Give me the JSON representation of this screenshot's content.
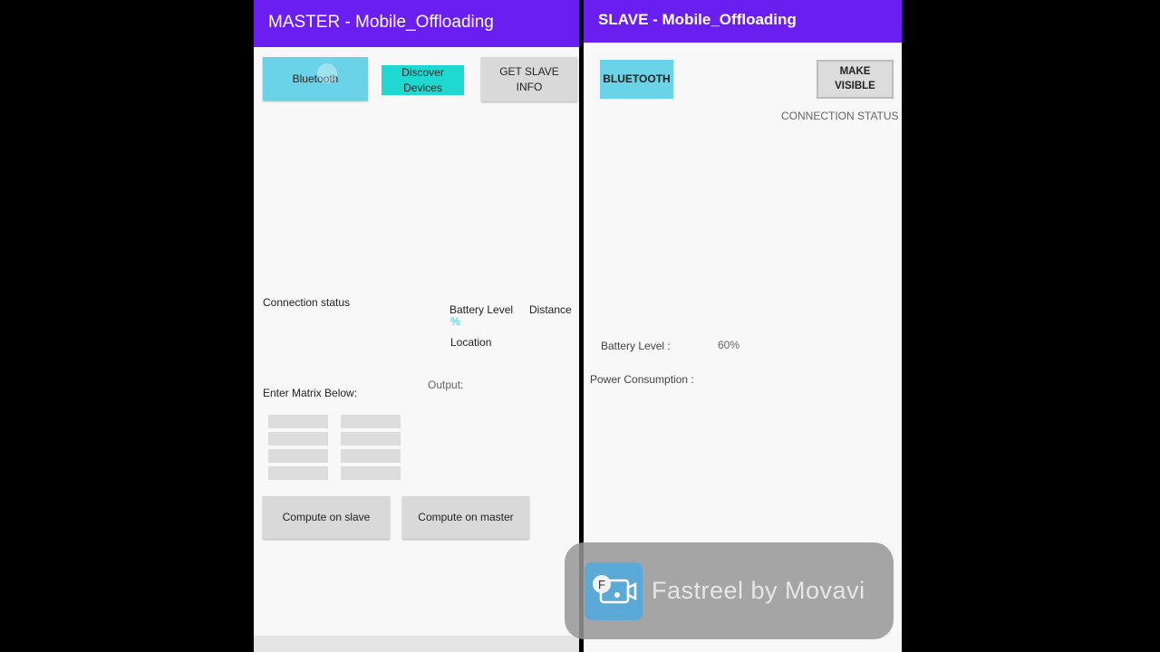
{
  "master": {
    "title": "MASTER - Mobile_Offloading",
    "bluetooth_button": "Bluetooth",
    "discover_button": "Discover Devices",
    "get_slave_info_button": "GET SLAVE\nINFO",
    "connection_status_label": "Connection status",
    "battery_level_label": "Battery Level",
    "battery_percent": "%",
    "distance_label": "Distance",
    "location_label": "Location",
    "enter_matrix_label": "Enter Matrix Below:",
    "output_label": "Output:",
    "compute_slave_button": "Compute on slave",
    "compute_master_button": "Compute on master"
  },
  "slave": {
    "title": "SLAVE - Mobile_Offloading",
    "bluetooth_button": "BLUETOOTH",
    "make_visible_button": "MAKE VISIBLE",
    "connection_status_label": "CONNECTION STATUS",
    "battery_level_label": "Battery Level :",
    "battery_level_value": "60%",
    "power_consumption_label": "Power Consumption :"
  },
  "watermark": {
    "text": "Fastreel by Movavi",
    "icon_letter": "F"
  },
  "colors": {
    "appbar": "#6a1ef0",
    "accent_light_blue": "#6ad3e8",
    "accent_teal": "#1fd8cf",
    "button_grey": "#d9d9d9"
  }
}
